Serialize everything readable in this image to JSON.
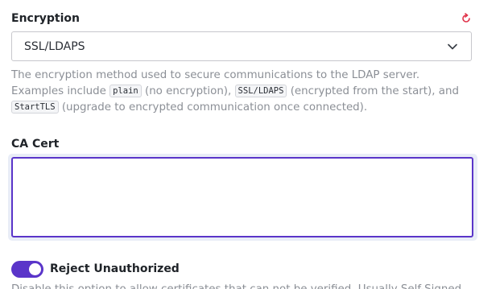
{
  "encryption": {
    "label": "Encryption",
    "reset_icon": "reset-icon",
    "selected_value": "SSL/LDAPS",
    "chevron_icon": "chevron-down-icon",
    "help": {
      "part1": "The encryption method used to secure communications to the LDAP server. Examples include ",
      "code_plain": "plain",
      "part2": " (no encryption), ",
      "code_ssl": "SSL/LDAPS",
      "part3": " (encrypted from the start), and ",
      "code_starttls": "StartTLS",
      "part4": " (upgrade to encrypted communication once connected)."
    }
  },
  "ca_cert": {
    "label": "CA Cert",
    "value": "",
    "placeholder": ""
  },
  "reject_unauthorized": {
    "label": "Reject Unauthorized",
    "enabled": true,
    "help_visible_part": "Disable this option to allow certificates that can not be verified. Usually Self-Signed"
  },
  "colors": {
    "accent": "#5a35c9",
    "reset_icon": "#e0334a",
    "help_text": "#8b8f96"
  }
}
